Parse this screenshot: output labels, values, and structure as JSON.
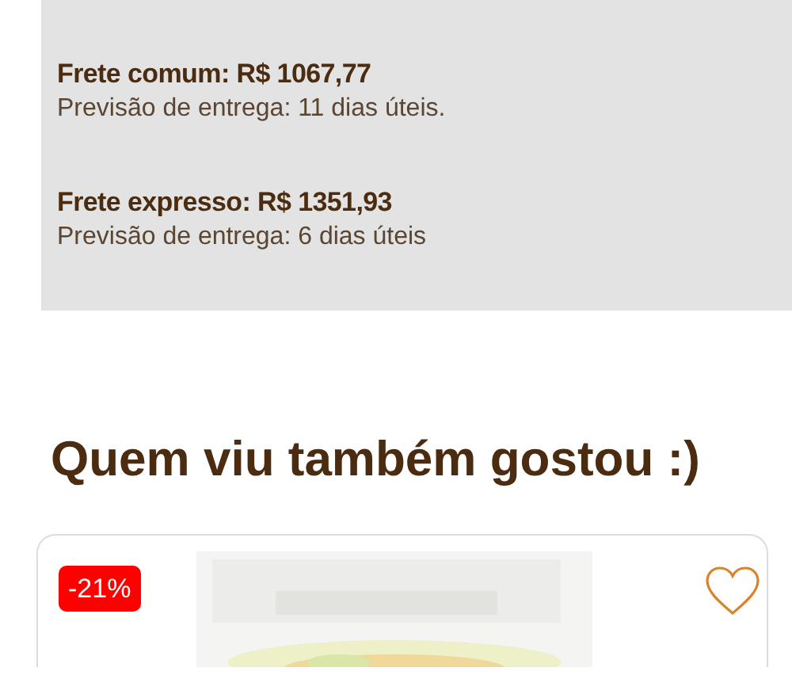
{
  "shipping_options": [
    {
      "title": "Frete comum: R$ 1067,77",
      "estimate": "Previsão de entrega: 11 dias úteis."
    },
    {
      "title": "Frete expresso: R$ 1351,93",
      "estimate": "Previsão de entrega: 6 dias úteis"
    }
  ],
  "related": {
    "heading": "Quem viu também gostou :)",
    "products": [
      {
        "discount": "-21%"
      }
    ]
  }
}
